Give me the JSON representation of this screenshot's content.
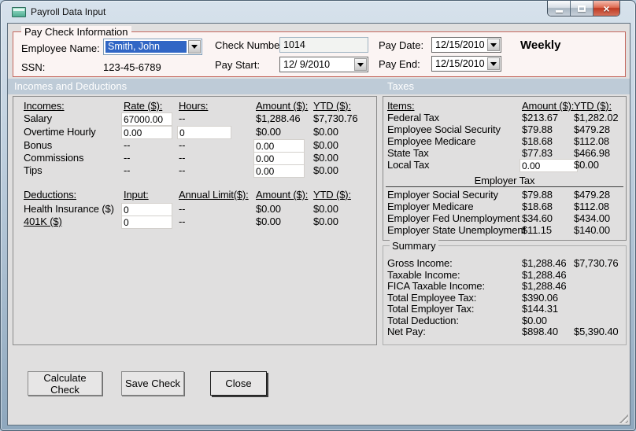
{
  "window": {
    "title": "Payroll Data Input"
  },
  "paycheck": {
    "group_label": "Pay Check Information",
    "employee_name_label": "Employee Name:",
    "employee_name_value": "Smith, John",
    "ssn_label": "SSN:",
    "ssn_value": "123-45-6789",
    "check_number_label": "Check Number:",
    "check_number_value": "1014",
    "pay_start_label": "Pay Start:",
    "pay_start_value": "12/ 9/2010",
    "pay_date_label": "Pay Date:",
    "pay_date_value": "12/15/2010",
    "pay_end_label": "Pay End:",
    "pay_end_value": "12/15/2010",
    "frequency": "Weekly"
  },
  "sections": {
    "incomes_deductions": "Incomes and Deductions",
    "taxes": "Taxes"
  },
  "incomes": {
    "headers": {
      "name": "Incomes:",
      "rate": "Rate ($):",
      "hours": "Hours:",
      "amount": "Amount ($):",
      "ytd": "YTD ($):"
    },
    "rows": [
      {
        "name": "Salary",
        "rate": "67000.00",
        "hours": "--",
        "amount": "$1,288.46",
        "ytd": "$7,730.76"
      },
      {
        "name": "Overtime Hourly",
        "rate": "0.00",
        "hours": "0",
        "amount": "$0.00",
        "ytd": "$0.00"
      },
      {
        "name": "Bonus",
        "rate": "--",
        "hours": "--",
        "amount": "0.00",
        "ytd": "$0.00"
      },
      {
        "name": "Commissions",
        "rate": "--",
        "hours": "--",
        "amount": "0.00",
        "ytd": "$0.00"
      },
      {
        "name": "Tips",
        "rate": "--",
        "hours": "--",
        "amount": "0.00",
        "ytd": "$0.00"
      }
    ]
  },
  "deductions": {
    "headers": {
      "name": "Deductions:",
      "input": "Input:",
      "limit": "Annual Limit($):",
      "amount": "Amount ($):",
      "ytd": "YTD ($):"
    },
    "rows": [
      {
        "name": "Health Insurance  ($)",
        "input": "0",
        "limit": "--",
        "amount": "$0.00",
        "ytd": "$0.00"
      },
      {
        "name": "401K  ($)",
        "input": "0",
        "limit": "--",
        "amount": "$0.00",
        "ytd": "$0.00"
      }
    ]
  },
  "taxes": {
    "headers": {
      "items": "Items:",
      "amount": "Amount ($):",
      "ytd": "YTD ($):"
    },
    "employee_rows": [
      {
        "name": "Federal Tax",
        "amount": "$213.67",
        "ytd": "$1,282.02"
      },
      {
        "name": "Employee Social Security",
        "amount": "$79.88",
        "ytd": "$479.28"
      },
      {
        "name": "Employee Medicare",
        "amount": "$18.68",
        "ytd": "$112.08"
      },
      {
        "name": "State Tax",
        "amount": "$77.83",
        "ytd": "$466.98"
      },
      {
        "name": "Local Tax",
        "amount": "0.00",
        "ytd": "$0.00"
      }
    ],
    "employer_header": "Employer Tax",
    "employer_rows": [
      {
        "name": "Employer Social Security",
        "amount": "$79.88",
        "ytd": "$479.28"
      },
      {
        "name": "Employer Medicare",
        "amount": "$18.68",
        "ytd": "$112.08"
      },
      {
        "name": "Employer Fed Unemployment",
        "amount": "$34.60",
        "ytd": "$434.00"
      },
      {
        "name": "Employer State Unemployment",
        "amount": "$11.15",
        "ytd": "$140.00"
      }
    ]
  },
  "summary": {
    "group_label": "Summary",
    "rows": [
      {
        "label": "Gross Income:",
        "amount": "$1,288.46",
        "ytd": "$7,730.76"
      },
      {
        "label": "Taxable Income:",
        "amount": "$1,288.46",
        "ytd": ""
      },
      {
        "label": "FICA Taxable Income:",
        "amount": "$1,288.46",
        "ytd": ""
      },
      {
        "label": "Total Employee Tax:",
        "amount": "$390.06",
        "ytd": ""
      },
      {
        "label": "Total Employer Tax:",
        "amount": "$144.31",
        "ytd": ""
      },
      {
        "label": "Total Deduction:",
        "amount": "$0.00",
        "ytd": ""
      },
      {
        "label": "Net Pay:",
        "amount": "$898.40",
        "ytd": "$5,390.40"
      }
    ]
  },
  "buttons": {
    "calculate": "Calculate Check",
    "save": "Save Check",
    "close": "Close"
  },
  "colors": {
    "group_border": "#C4685E",
    "band_bg": "#BECBD7",
    "selection_blue": "#3166C5",
    "close_red": "#C03A22",
    "client_bg": "#E0DFDF"
  }
}
